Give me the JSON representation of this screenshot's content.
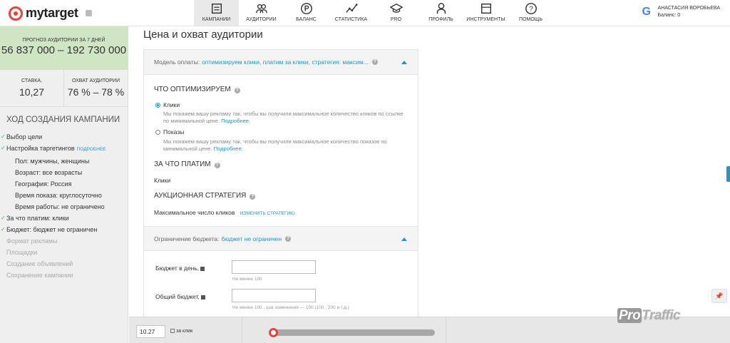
{
  "header": {
    "logo_text": "mytarget",
    "nav": [
      {
        "label": "КАМПАНИИ",
        "icon": "campaigns-icon",
        "active": true
      },
      {
        "label": "АУДИТОРИИ",
        "icon": "audiences-icon",
        "active": false
      },
      {
        "label": "БАЛАНС",
        "icon": "ruble-icon",
        "active": false
      },
      {
        "label": "СТАТИСТИКА",
        "icon": "statistics-icon",
        "active": false
      },
      {
        "label": "PRO",
        "icon": "graduation-cap-icon",
        "active": false
      },
      {
        "label": "ПРОФИЛЬ",
        "icon": "profile-icon",
        "active": false
      },
      {
        "label": "ИНСТРУМЕНТЫ",
        "icon": "tools-icon",
        "active": false
      },
      {
        "label": "ПОМОЩЬ",
        "icon": "help-icon",
        "active": false
      }
    ],
    "user_name": "АНАСТАСИЯ ВОРОБЬЕВА",
    "balance": "Баланс: 0"
  },
  "sidebar": {
    "forecast_label": "ПРОГНОЗ АУДИТОРИИ ЗА 7 ДНЕЙ",
    "forecast_value": "56 837 000 – 192 730 000",
    "bid_label": "СТАВКА,",
    "bid_value": "10,27",
    "reach_label": "ОХВАТ АУДИТОРИИ",
    "reach_value": "76 % – 78 %",
    "progress_title": "ХОД СОЗДАНИЯ КАМПАНИИ",
    "steps": [
      {
        "label": "Выбор цели",
        "done": true
      },
      {
        "label": "Настройка таргетингов",
        "done": true,
        "link": "ПОДРОБНЕЕ"
      },
      {
        "label": "Пол: мужчины, женщины",
        "sub": true
      },
      {
        "label": "Возраст: все возрасты",
        "sub": true
      },
      {
        "label": "География: Россия",
        "sub": true
      },
      {
        "label": "Время показа: круглосуточно",
        "sub": true
      },
      {
        "label": "Время работы: не ограничено",
        "sub": true
      },
      {
        "label": "За что платим: клики",
        "done": true
      },
      {
        "label": "Бюджет: бюджет не ограничен",
        "done": true
      },
      {
        "label": "Формат рекламы",
        "muted": true
      },
      {
        "label": "Площадки",
        "muted": true
      },
      {
        "label": "Создание объявлений",
        "muted": true
      },
      {
        "label": "Сохранение кампании",
        "muted": true
      }
    ]
  },
  "main": {
    "page_title": "Цена и охват аудитории",
    "payment_model_label": "Модель оплаты:",
    "payment_model_value": "оптимизируем клики, платим за клики, стратегия: максим...",
    "optimize_title": "ЧТО ОПТИМИЗИРУЕМ",
    "option_clicks": "Клики",
    "option_clicks_desc": "Мы покажем вашу рекламу так, чтобы вы получили максимальное количество кликов по ссылке по минимальной цене.",
    "option_views": "Показы",
    "option_views_desc": "Мы покажем вашу рекламу так, чтобы вы получили максимальное количество показов по минимальной цене.",
    "more_link": "Подробнее.",
    "pay_for_title": "ЗА ЧТО ПЛАТИМ",
    "pay_for_value": "Клики",
    "strategy_title": "АУКЦИОННАЯ СТРАТЕГИЯ",
    "strategy_value": "Максимальное число кликов",
    "strategy_change": "ИЗМЕНИТЬ СТРАТЕГИЮ",
    "budget_limit_label": "Ограничение бюджета:",
    "budget_limit_value": "бюджет не ограничен",
    "daily_budget_label": "Бюджет в день,",
    "daily_budget_hint": "Не менее 100",
    "total_budget_label": "Общий бюджет,",
    "total_budget_hint": "Не менее 100 , шаг изменения — 100  (100 , 200  и т.д.)"
  },
  "bottombar": {
    "bid_value": "10.27",
    "bid_unit": "за клик",
    "slider_level": 0.0
  },
  "watermark": {
    "pro": "Pro",
    "traffic": "Traffic"
  },
  "colors": {
    "accent": "#2196c4",
    "brand": "#e9423b",
    "forecast_bg": "#cfe5c3"
  }
}
